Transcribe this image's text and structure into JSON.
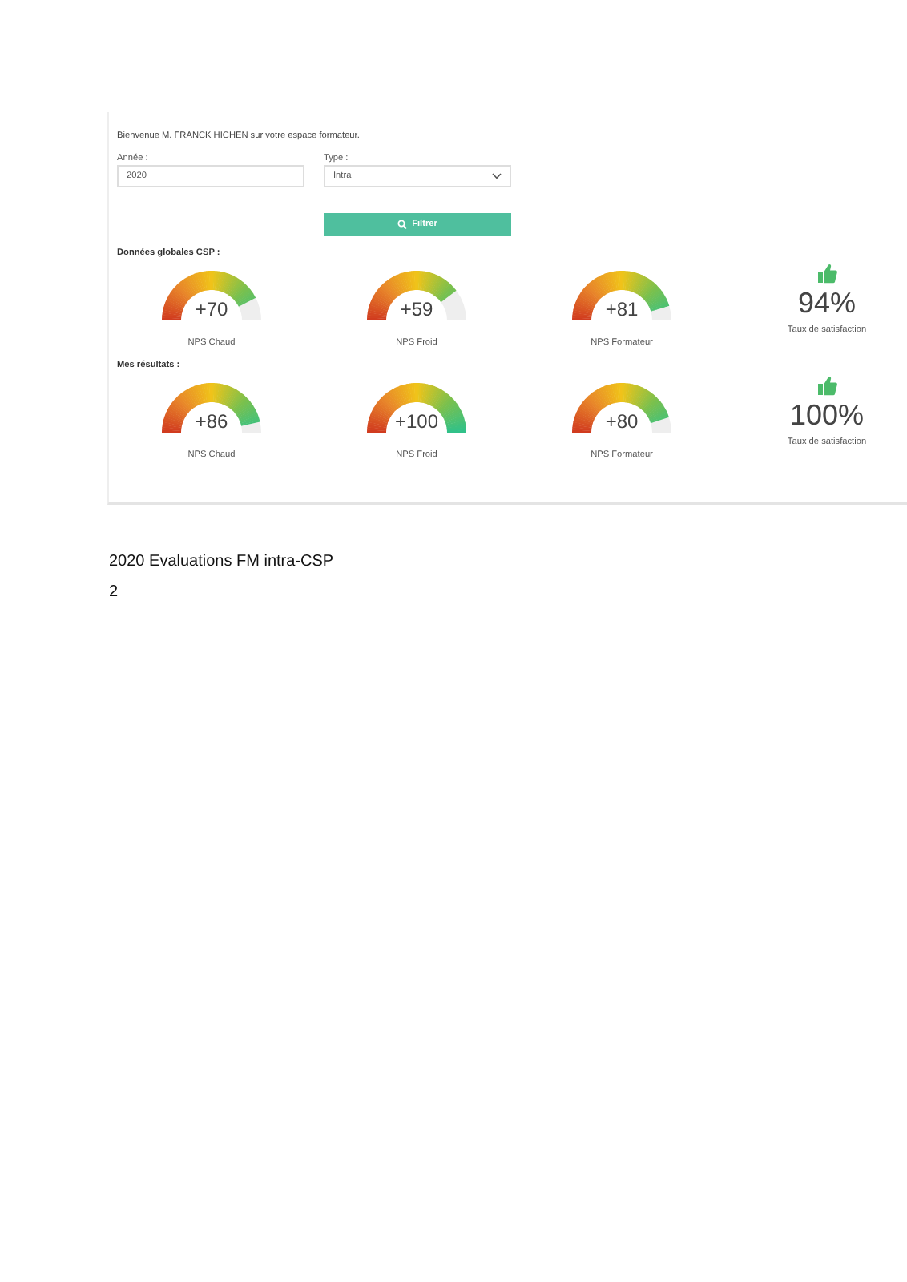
{
  "welcome": "Bienvenue M. FRANCK HICHEN sur votre espace formateur.",
  "filters": {
    "year": {
      "label": "Année :",
      "value": "2020"
    },
    "type": {
      "label": "Type :",
      "value": "Intra"
    },
    "button": "Filtrer"
  },
  "sections": [
    {
      "title": "Données globales CSP :",
      "gauges": [
        {
          "value": "+70",
          "label": "NPS Chaud"
        },
        {
          "value": "+59",
          "label": "NPS Froid"
        },
        {
          "value": "+81",
          "label": "NPS Formateur"
        }
      ],
      "satisfaction": {
        "value": "94%",
        "label": "Taux de satisfaction"
      }
    },
    {
      "title": "Mes résultats :",
      "gauges": [
        {
          "value": "+86",
          "label": "NPS Chaud"
        },
        {
          "value": "+100",
          "label": "NPS Froid"
        },
        {
          "value": "+80",
          "label": "NPS Formateur"
        }
      ],
      "satisfaction": {
        "value": "100%",
        "label": "Taux de satisfaction"
      }
    }
  ],
  "caption": "2020 Evaluations FM intra-CSP",
  "page_number": "2"
}
